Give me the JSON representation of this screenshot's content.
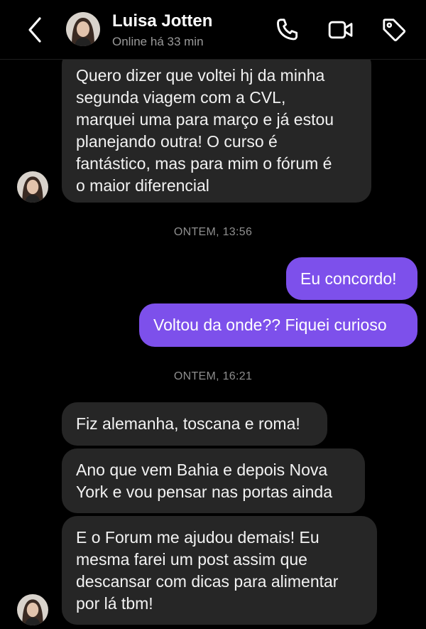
{
  "header": {
    "contact_name": "Luisa Jotten",
    "status": "Online há 33 min",
    "icons": [
      "back-chevron-icon",
      "phone-icon",
      "video-camera-icon",
      "tag-icon"
    ]
  },
  "colors": {
    "background": "#000000",
    "incoming_bubble": "#262626",
    "outgoing_bubble": "#7d50eb",
    "timestamp": "#8e8e8e"
  },
  "messages": [
    {
      "from": "contact",
      "lines": [
        "Quero dizer que voltei hj da minha",
        "segunda viagem com a CVL,",
        "marquei uma para março e já estou",
        "planejando outra! O curso é",
        "fantástico, mas para mim o fórum é",
        "o maior diferencial"
      ]
    },
    {
      "timestamp": "ONTEM, 13:56"
    },
    {
      "from": "me",
      "lines": [
        "Eu concordo!"
      ]
    },
    {
      "from": "me",
      "lines": [
        "Voltou da onde?? Fiquei curioso"
      ]
    },
    {
      "timestamp": "ONTEM, 16:21"
    },
    {
      "from": "contact",
      "lines": [
        "Fiz alemanha, toscana e roma!"
      ]
    },
    {
      "from": "contact",
      "lines": [
        "Ano que vem Bahia e depois Nova",
        "York e vou pensar nas portas ainda"
      ]
    },
    {
      "from": "contact",
      "lines": [
        "E o Forum me ajudou demais! Eu",
        "mesma farei um post assim que",
        "descansar com dicas para alimentar",
        "por lá tbm!"
      ]
    }
  ]
}
